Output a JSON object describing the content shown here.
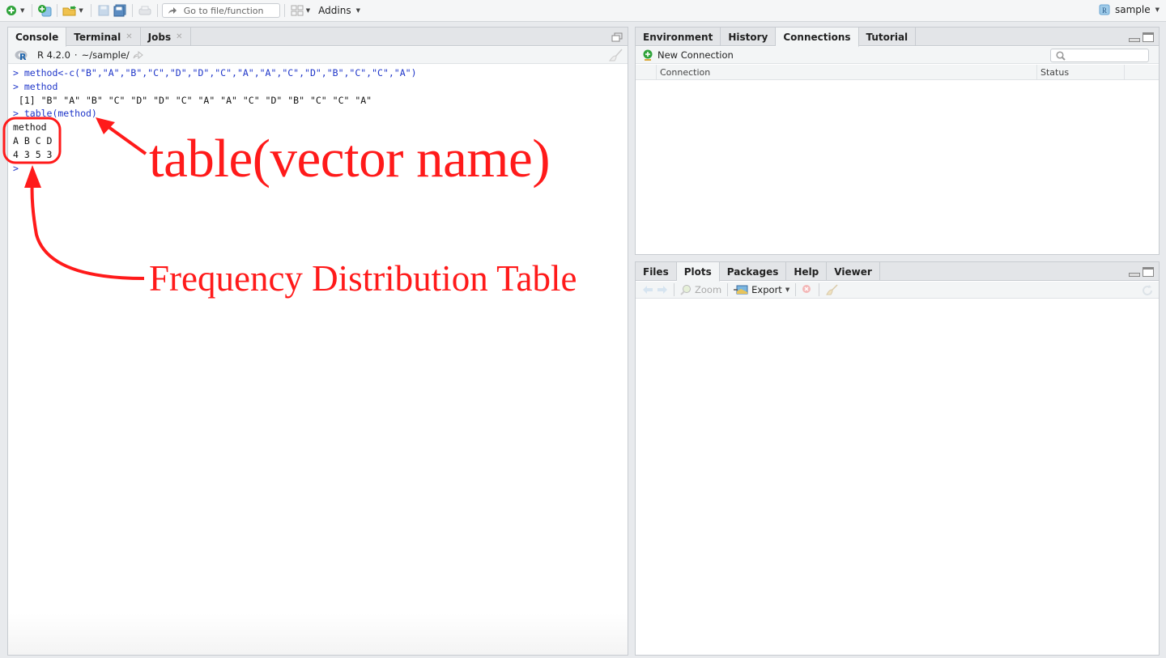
{
  "toolbar": {
    "goto_placeholder": "Go to file/function",
    "addins_label": "Addins",
    "project_name": "sample",
    "icons": [
      "new-file-icon",
      "new-project-icon",
      "open-file-icon",
      "save-icon",
      "save-all-icon",
      "print-icon",
      "grid-layout-icon"
    ]
  },
  "console_pane": {
    "tabs": [
      {
        "label": "Console",
        "active": true,
        "closable": false
      },
      {
        "label": "Terminal",
        "active": false,
        "closable": true
      },
      {
        "label": "Jobs",
        "active": false,
        "closable": true
      }
    ],
    "r_version": "R 4.2.0",
    "separator": "·",
    "working_dir": "~/sample/",
    "lines": [
      {
        "type": "input",
        "text": "> method<-c(\"B\",\"A\",\"B\",\"C\",\"D\",\"D\",\"C\",\"A\",\"A\",\"C\",\"D\",\"B\",\"C\",\"C\",\"A\")"
      },
      {
        "type": "input",
        "text": "> method"
      },
      {
        "type": "output",
        "text": " [1] \"B\" \"A\" \"B\" \"C\" \"D\" \"D\" \"C\" \"A\" \"A\" \"C\" \"D\" \"B\" \"C\" \"C\" \"A\""
      },
      {
        "type": "input",
        "text": "> table(method)"
      },
      {
        "type": "output",
        "text": "method"
      },
      {
        "type": "output",
        "text": "A B C D "
      },
      {
        "type": "output",
        "text": "4 3 5 3 "
      },
      {
        "type": "input",
        "text": "> "
      }
    ]
  },
  "annotations": {
    "table_label": "table(vector name)",
    "freq_label": "Frequency Distribution Table",
    "color": "#ff1a1a"
  },
  "env_pane": {
    "tabs": [
      {
        "label": "Environment",
        "active": false
      },
      {
        "label": "History",
        "active": false
      },
      {
        "label": "Connections",
        "active": true
      },
      {
        "label": "Tutorial",
        "active": false
      }
    ],
    "new_connection_label": "New Connection",
    "search_placeholder": "",
    "columns": [
      "Connection",
      "Status"
    ]
  },
  "files_pane": {
    "tabs": [
      {
        "label": "Files",
        "active": false
      },
      {
        "label": "Plots",
        "active": true
      },
      {
        "label": "Packages",
        "active": false
      },
      {
        "label": "Help",
        "active": false
      },
      {
        "label": "Viewer",
        "active": false
      }
    ],
    "zoom_label": "Zoom",
    "export_label": "Export"
  }
}
